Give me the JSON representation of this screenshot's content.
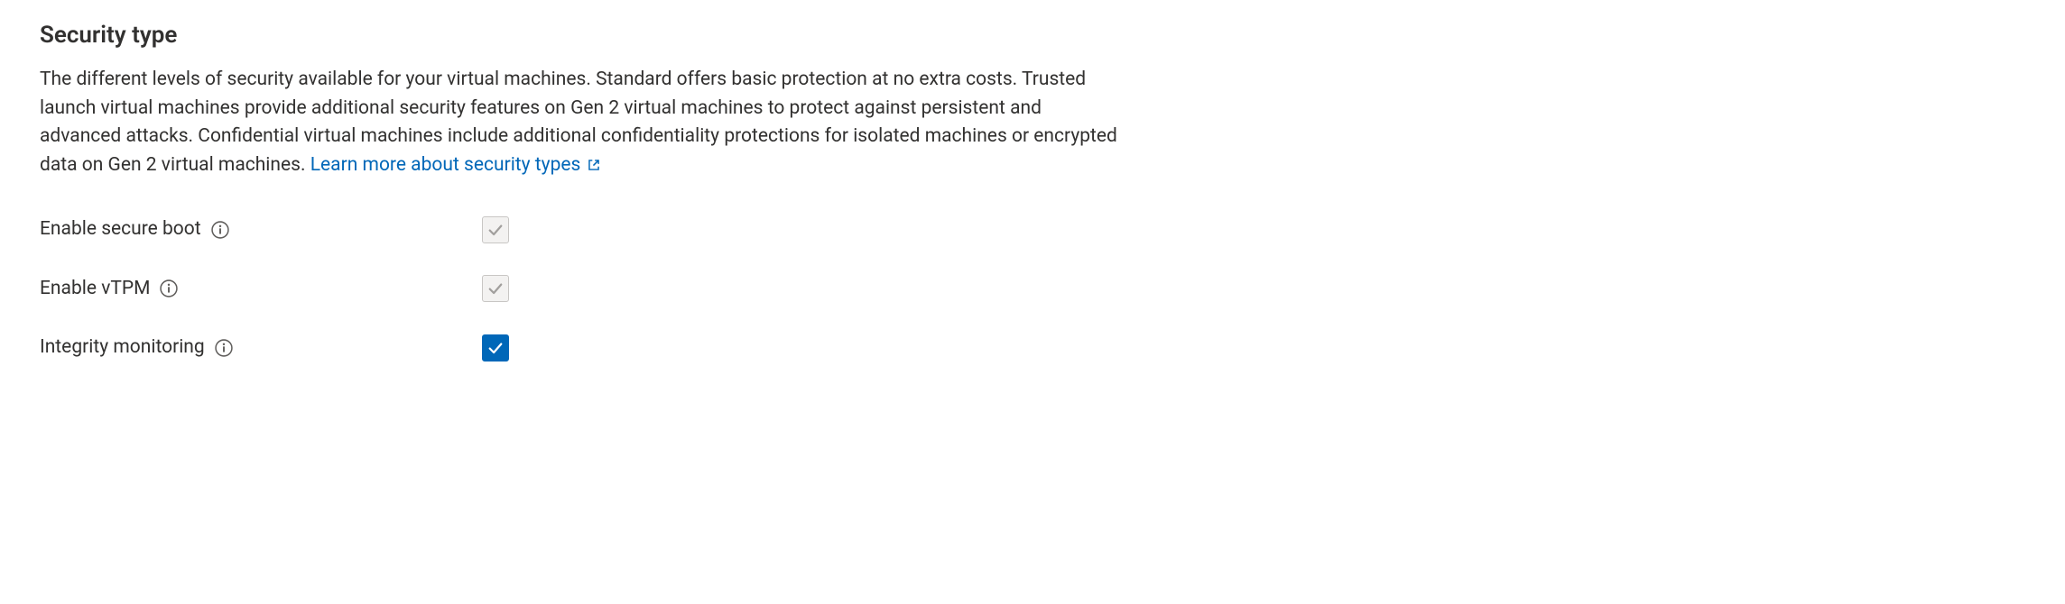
{
  "heading": "Security type",
  "description": "The different levels of security available for your virtual machines. Standard offers basic protection at no extra costs. Trusted launch virtual machines provide additional security features on Gen 2 virtual machines to protect against persistent and advanced attacks. Confidential virtual machines include additional confidentiality protections for isolated machines or encrypted data on Gen 2 virtual machines. ",
  "learn_more_label": "Learn more about security types",
  "options": {
    "secure_boot": {
      "label": "Enable secure boot",
      "checked": true,
      "disabled": true
    },
    "vtpm": {
      "label": "Enable vTPM",
      "checked": true,
      "disabled": true
    },
    "integrity": {
      "label": "Integrity monitoring",
      "checked": true,
      "disabled": false
    }
  },
  "colors": {
    "link": "#0067b8",
    "checkbox_checked": "#0067b8",
    "text": "#323130"
  }
}
